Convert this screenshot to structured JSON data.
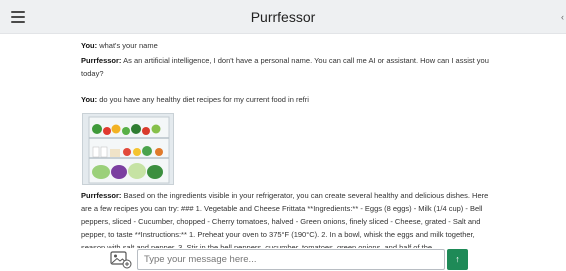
{
  "header": {
    "title": "Purrfessor",
    "menu_icon": "hamburger-menu-icon",
    "edge_mark": "‹"
  },
  "messages": [
    {
      "speaker": "You:",
      "text": " what's your name"
    },
    {
      "speaker": "Purrfessor:",
      "text": " As an artificial intelligence, I don't have a personal name. You can call me AI or assistant. How can I assist you today?"
    },
    {
      "speaker": "You:",
      "text": " do you have any healthy diet recipes for my current food in refri"
    },
    {
      "speaker": "Purrfessor:",
      "text": " Based on the ingredients visible in your refrigerator, you can create several healthy and delicious dishes. Here are a few recipes you can try: ### 1. Vegetable and Cheese Frittata **Ingredients:** - Eggs (8 eggs) - Milk (1/4 cup) - Bell peppers, sliced - Cucumber, chopped - Cherry tomatoes, halved - Green onions, finely sliced - Cheese, grated - Salt and pepper, to taste **Instructions:** 1. Preheat your oven to 375°F (190°C). 2. In a bowl, whisk the eggs and milk together, season with salt and pepper. 3. Stir in the bell peppers, cucumber, tomatoes, green onions, and half of the"
    }
  ],
  "attachment": {
    "type": "image",
    "subject": "open refrigerator with fresh vegetables"
  },
  "composer": {
    "placeholder": "Type your message here...",
    "attach_icon": "image-upload-icon",
    "send_icon": "arrow-up-icon",
    "send_label": "↑",
    "send_color": "#1e8a57"
  }
}
